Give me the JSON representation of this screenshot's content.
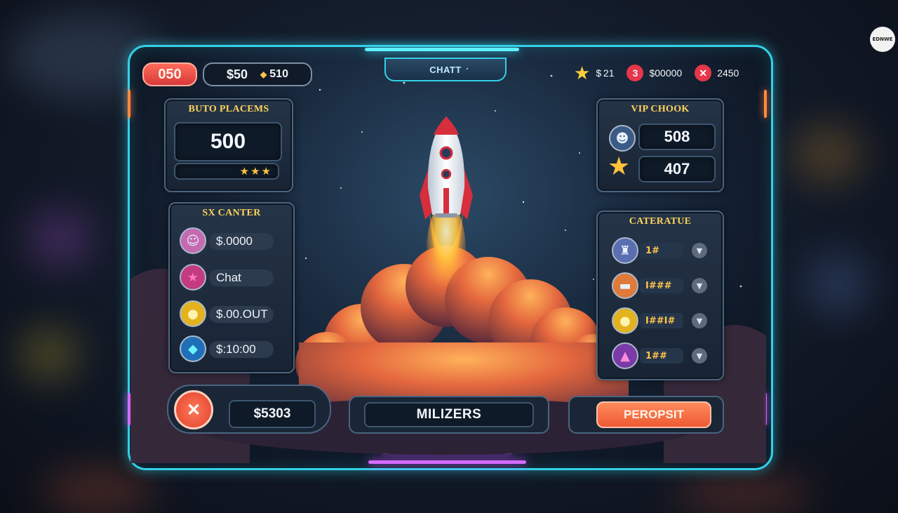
{
  "header": {
    "title": "CHATT",
    "coins_badge": "050",
    "balance": "$50",
    "gems": "510",
    "star_value": "$ 21",
    "level_badge": "3",
    "cash_value": "$00000",
    "close_value": "2450"
  },
  "corner_logo": "EDNWE",
  "left_top_card": {
    "title": "BUTO PLACEMS",
    "amount": "500",
    "stars": 3
  },
  "left_list_card": {
    "title": "SX CANTER",
    "items": [
      {
        "icon": "face-icon",
        "value": "$.0000"
      },
      {
        "icon": "star-icon",
        "value": "Chat"
      },
      {
        "icon": "coin-icon",
        "value": "$.00.OUT"
      },
      {
        "icon": "diamond-icon",
        "value": "$:10:00"
      }
    ]
  },
  "right_top_card": {
    "title": "VIP CHOOK",
    "rows": [
      {
        "icon": "avatar-icon",
        "value": "508"
      },
      {
        "icon": "star-icon",
        "value": "407"
      }
    ]
  },
  "right_list_card": {
    "title": "CATERATUE",
    "items": [
      {
        "icon": "cup-icon",
        "value": "1#"
      },
      {
        "icon": "jar-icon",
        "value": "I###"
      },
      {
        "icon": "coin-icon",
        "value": "I##I#"
      },
      {
        "icon": "gem-icon",
        "value": "1##"
      }
    ]
  },
  "bottom": {
    "cancel_amount": "$5303",
    "center_label": "MILIZERS",
    "action_label": "PEROPSIT"
  },
  "colors": {
    "accent_cyan": "#33d1e8",
    "accent_pink": "#c94dff",
    "accent_orange": "#ff6a3d",
    "gold": "#ffd35c"
  }
}
